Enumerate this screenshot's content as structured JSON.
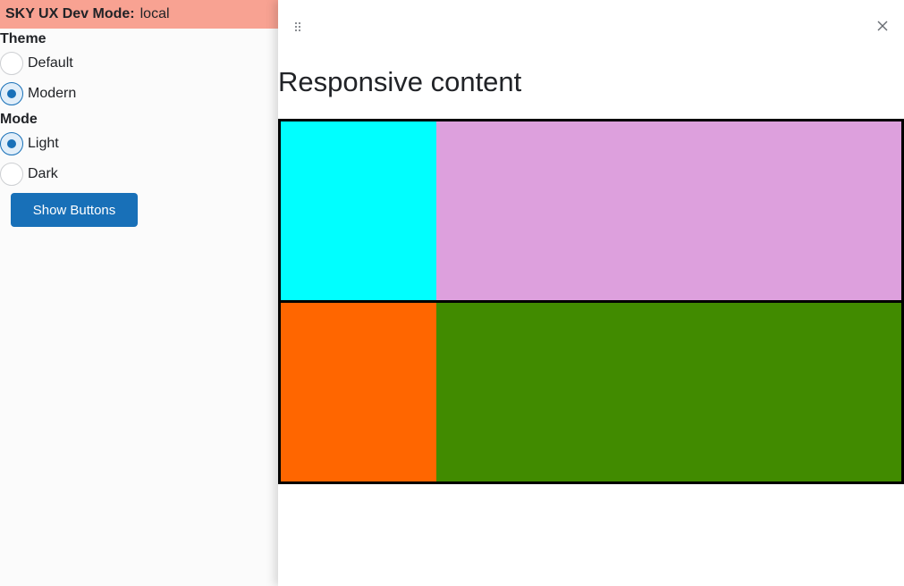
{
  "dev_bar": {
    "title": "SKY UX Dev Mode:",
    "value": "local"
  },
  "theme": {
    "label": "Theme",
    "options": [
      {
        "label": "Default",
        "checked": false
      },
      {
        "label": "Modern",
        "checked": true
      }
    ]
  },
  "mode": {
    "label": "Mode",
    "options": [
      {
        "label": "Light",
        "checked": true
      },
      {
        "label": "Dark",
        "checked": false
      }
    ]
  },
  "show_buttons_label": "Show Buttons",
  "flyout": {
    "title": "Responsive content",
    "close_icon": "close-icon",
    "drag_icon": "drag-handle-icon",
    "boxes": [
      {
        "color": "#00ffff"
      },
      {
        "color": "#dda0dd"
      },
      {
        "color": "#ff6600"
      },
      {
        "color": "#418b00"
      }
    ]
  },
  "colors": {
    "dev_bar_bg": "#f8a292",
    "accent": "#1870b8",
    "panel_bg": "#fbfbfb"
  }
}
